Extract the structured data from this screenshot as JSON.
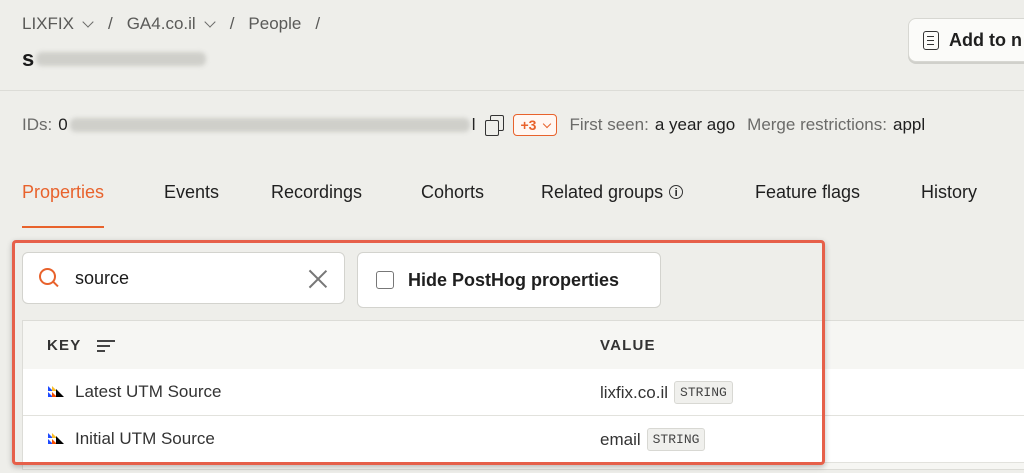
{
  "breadcrumb": {
    "org": "LIXFIX",
    "project": "GA4.co.il",
    "section": "People",
    "separator": "/"
  },
  "person": {
    "name_initial": "s"
  },
  "header": {
    "add_button_label": "Add to n"
  },
  "ids_row": {
    "ids_label": "IDs:",
    "id_prefix": "0",
    "id_suffix": "l",
    "more_ids_badge": "+3",
    "first_seen_label": "First seen:",
    "first_seen_value": "a year ago",
    "merge_label": "Merge restrictions:",
    "merge_value": "appl"
  },
  "tabs": [
    {
      "label": "Properties",
      "active": true
    },
    {
      "label": "Events"
    },
    {
      "label": "Recordings"
    },
    {
      "label": "Cohorts"
    },
    {
      "label": "Related groups"
    },
    {
      "label": "Feature flags"
    },
    {
      "label": "History"
    }
  ],
  "search": {
    "value": "source"
  },
  "filter": {
    "hide_posthog_label": "Hide PostHog properties",
    "checked": false
  },
  "table": {
    "columns": {
      "key": "KEY",
      "value": "VALUE"
    },
    "rows": [
      {
        "key": "Latest UTM Source",
        "value": "lixfix.co.il",
        "type": "STRING"
      },
      {
        "key": "Initial UTM Source",
        "value": "email",
        "type": "STRING"
      }
    ]
  },
  "colors": {
    "accent": "#e8622c",
    "highlight_border": "#e6604a",
    "background": "#eeeeea"
  }
}
